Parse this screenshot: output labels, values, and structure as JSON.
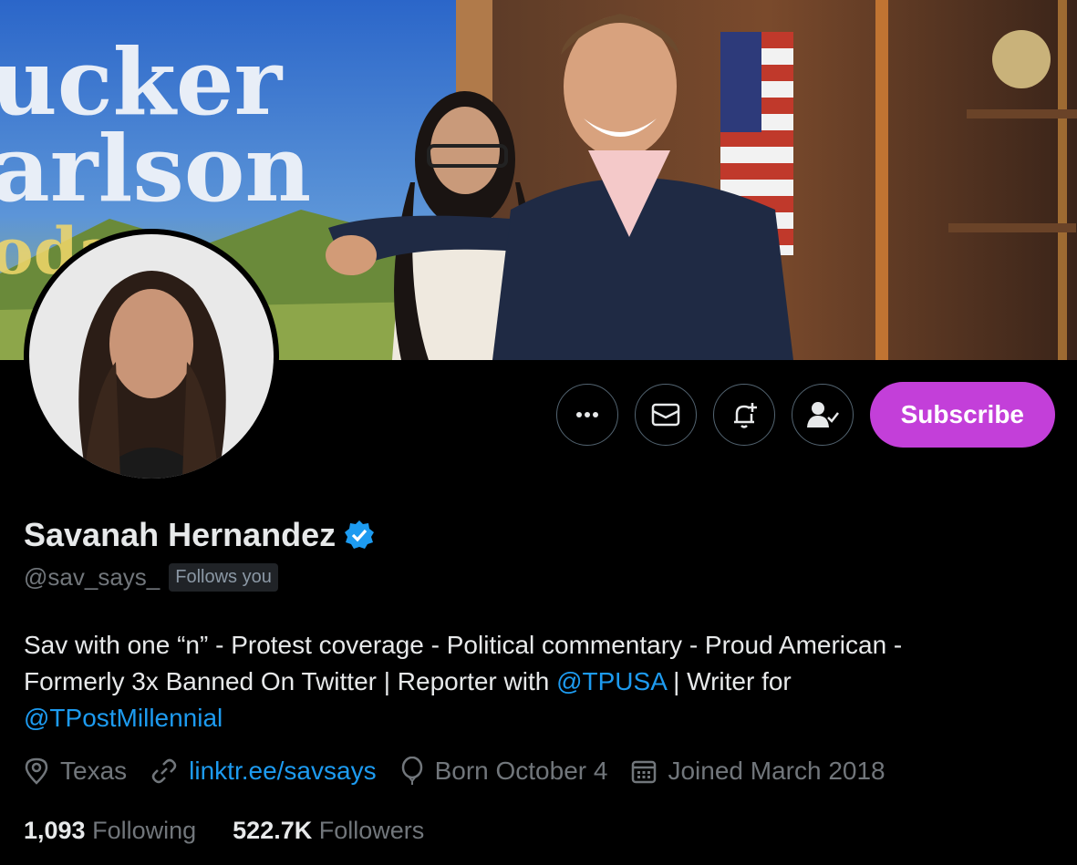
{
  "banner": {
    "alt_text_lines": [
      "ucker",
      "arlson",
      "oday"
    ]
  },
  "actions": {
    "more_icon": "more-horizontal-icon",
    "message_icon": "envelope-icon",
    "notify_icon": "bell-plus-icon",
    "following_icon": "person-check-icon",
    "subscribe_label": "Subscribe",
    "subscribe_color": "#c33fd9"
  },
  "profile": {
    "name": "Savanah Hernandez",
    "handle": "@sav_says_",
    "follows_you": "Follows you",
    "verified_color": "#1d9bf0"
  },
  "bio": {
    "line1": "Sav with one “n” - Protest coverage - Political commentary - Proud American -",
    "line2_a": "Formerly 3x Banned On Twitter | Reporter with ",
    "mention1": "@TPUSA",
    "line2_b": " | Writer for",
    "mention2": "@TPostMillennial"
  },
  "meta": {
    "location": "Texas",
    "link": "linktr.ee/savsays",
    "birthday": "Born October 4",
    "joined": "Joined March 2018"
  },
  "stats": {
    "following_count": "1,093",
    "following_label": "Following",
    "followers_count": "522.7K",
    "followers_label": "Followers"
  }
}
